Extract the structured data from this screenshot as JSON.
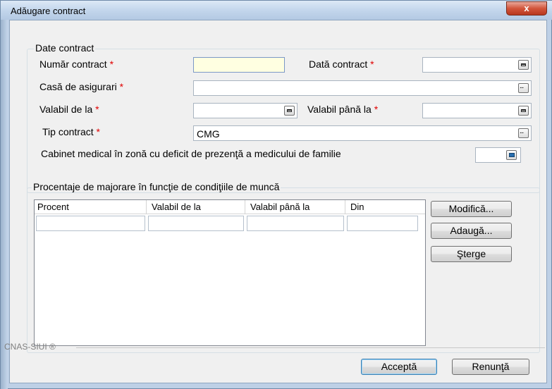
{
  "window": {
    "title": "Adăugare contract",
    "close_label": "x"
  },
  "contract_group": {
    "legend": "Date contract",
    "numar_contract": {
      "label": "Număr contract",
      "required": "*",
      "value": ""
    },
    "data_contract": {
      "label": "Dată contract",
      "required": "*",
      "value": ""
    },
    "casa_asigurari": {
      "label": "Casă de asigurari",
      "required": "*",
      "value": ""
    },
    "valabil_de_la": {
      "label": "Valabil de la",
      "required": "*",
      "value": ""
    },
    "valabil_pana_la": {
      "label": "Valabil până la",
      "required": "*",
      "value": ""
    },
    "tip_contract": {
      "label": "Tip contract",
      "required": "*",
      "value": "CMG"
    },
    "cabinet_deficit": {
      "label": "Cabinet medical în zonă cu deficit de prezenţă a medicului de familie",
      "checked": true
    }
  },
  "majorare_group": {
    "legend": "Procentaje de majorare în funcţie de condiţiile de muncă",
    "columns": [
      "Procent",
      "Valabil de la",
      "Valabil până la",
      "Din"
    ],
    "filters": [
      "",
      "",
      "",
      ""
    ],
    "rows": []
  },
  "actions": {
    "modifica": "Modifică...",
    "adauga": "Adaugă...",
    "sterge": "Şterge"
  },
  "footer": {
    "brand": "CNAS-SIUI ®",
    "accepta": "Acceptă",
    "renunta": "Renunţă"
  }
}
